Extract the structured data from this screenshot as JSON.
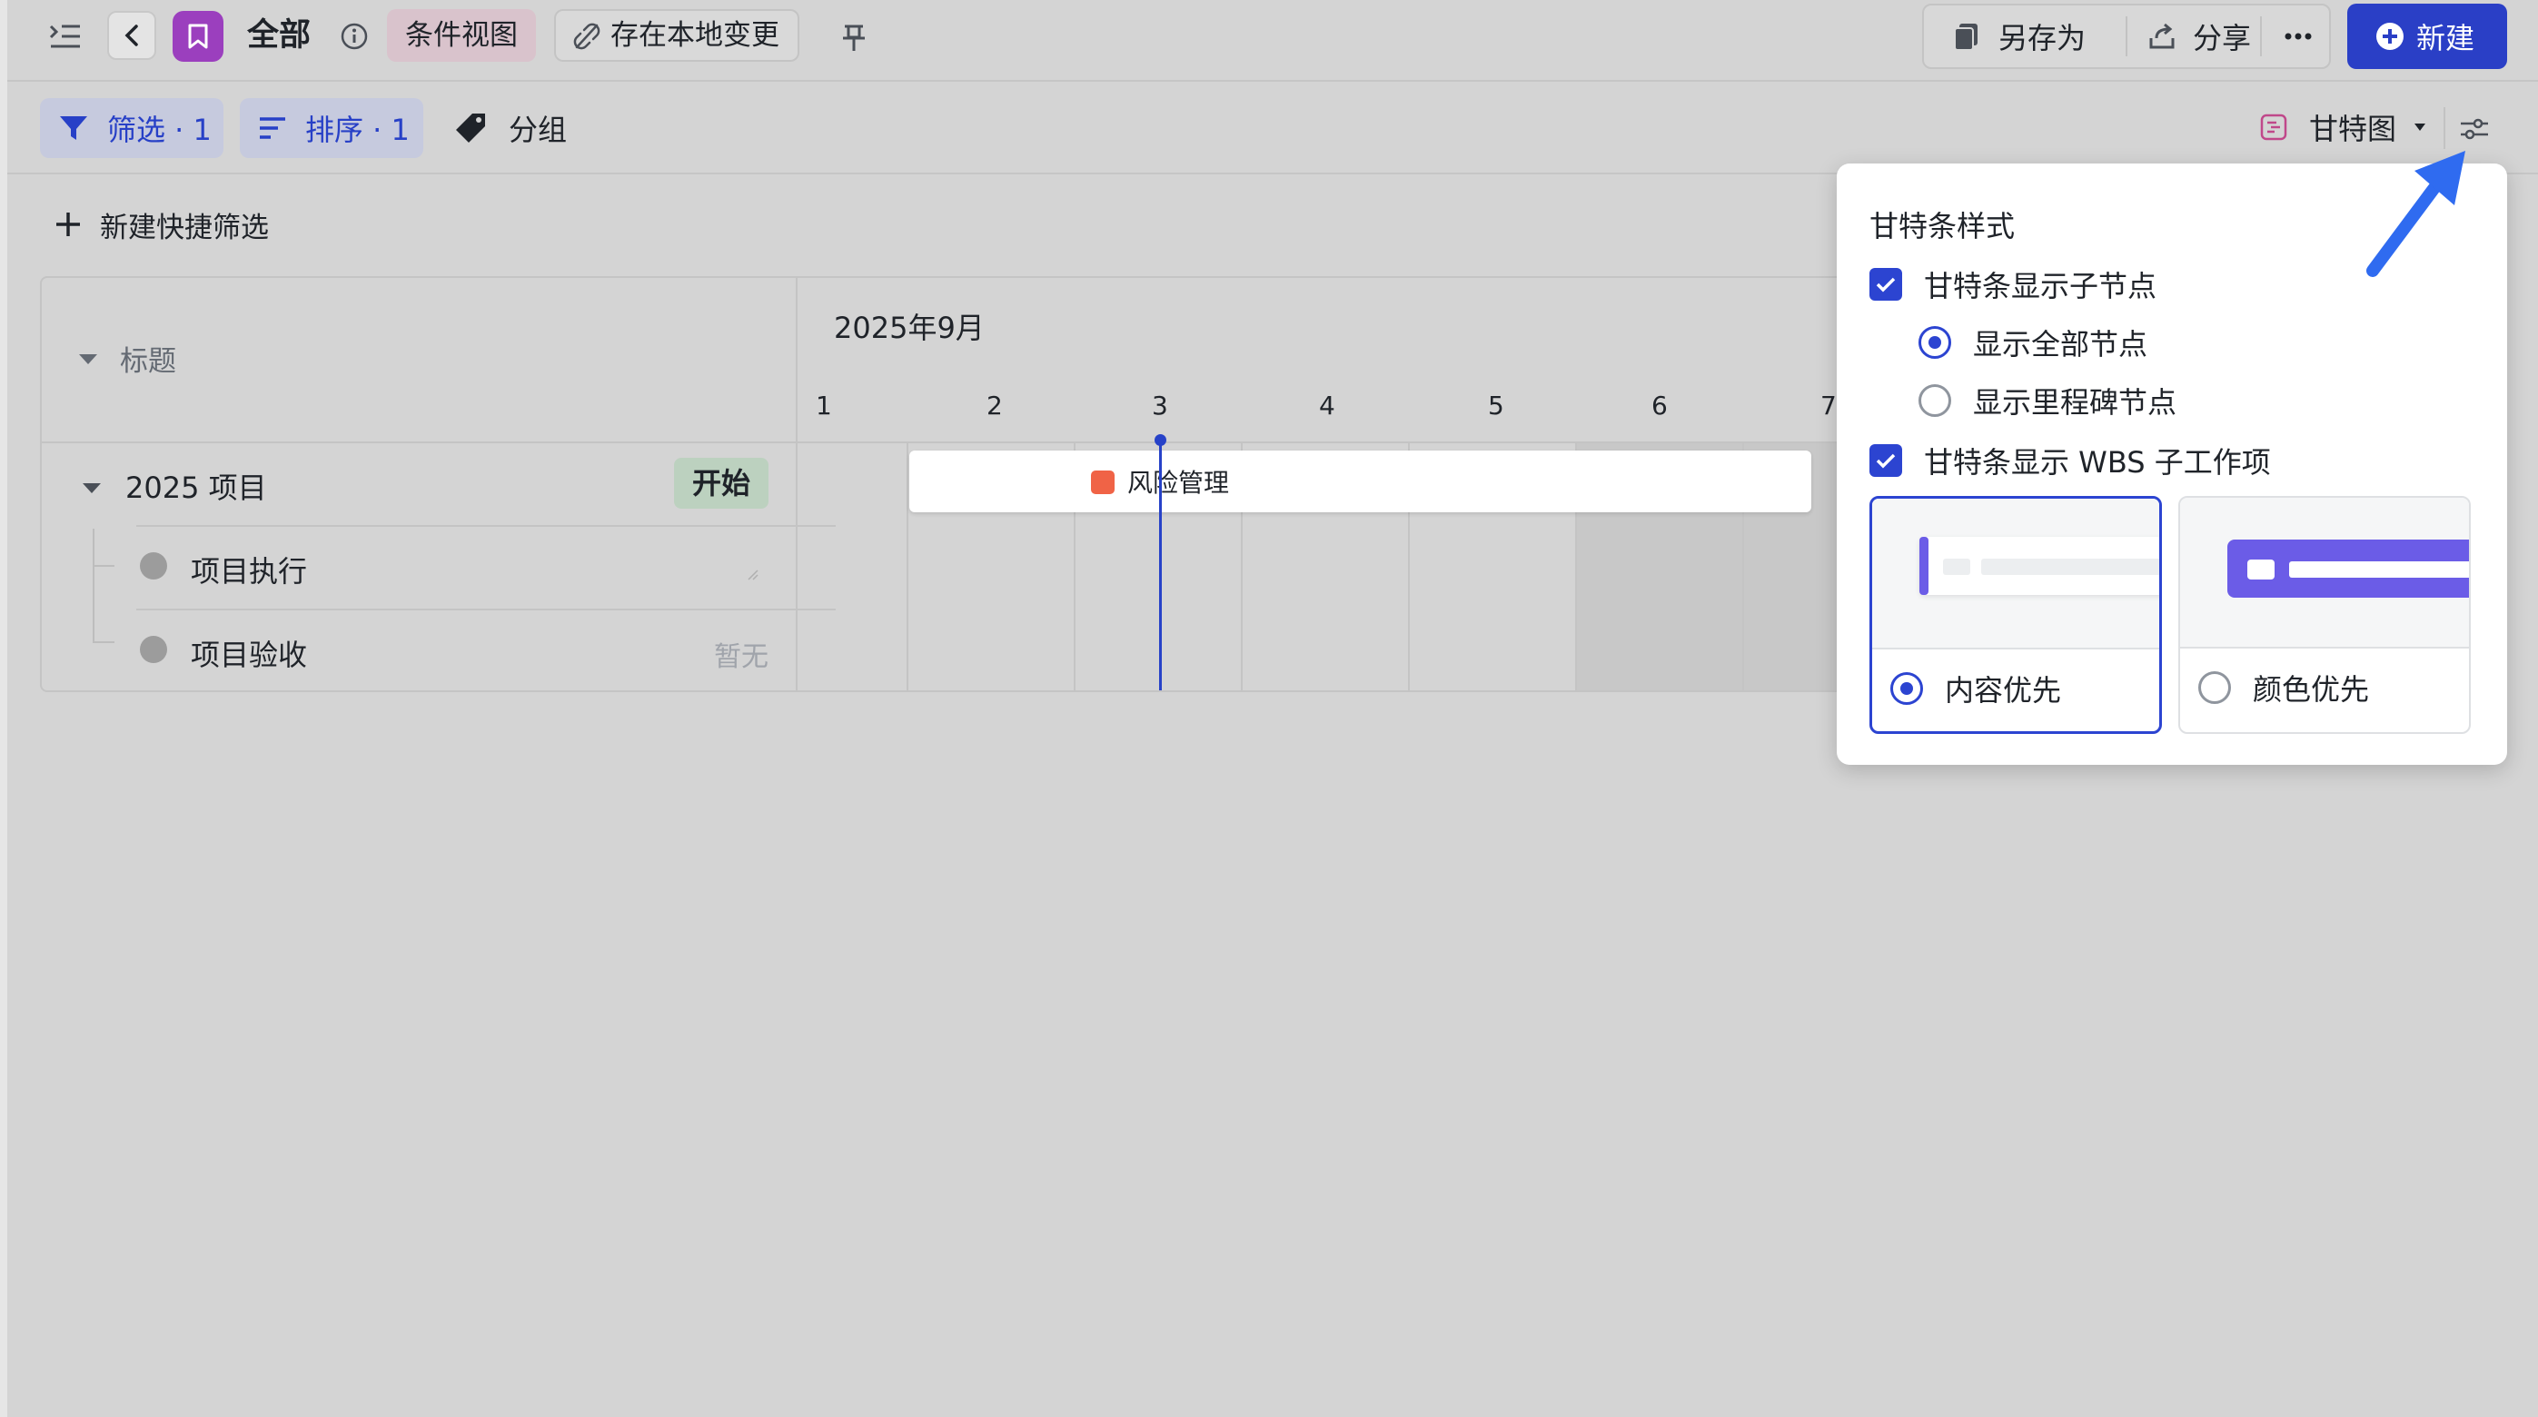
{
  "header": {
    "title": "全部",
    "view_chip": "条件视图",
    "local_chip": "存在本地变更",
    "save_as": "另存为",
    "share": "分享",
    "new_button": "新建"
  },
  "toolbar": {
    "filter": "筛选 · 1",
    "sort": "排序 · 1",
    "group": "分组",
    "view_type": "甘特图"
  },
  "quick_filter": "新建快捷筛选",
  "table": {
    "column_title": "标题",
    "month": "2025年9月",
    "days": [
      "1",
      "2",
      "3",
      "4",
      "5",
      "6",
      "7"
    ],
    "rows": [
      {
        "title": "2025 项目",
        "status": "开始",
        "bar_label": "风险管理"
      },
      {
        "title": "项目执行"
      },
      {
        "title": "项目验收",
        "status": "暂无"
      }
    ]
  },
  "popover": {
    "section_title": "甘特条样式",
    "show_children": "甘特条显示子节点",
    "show_all_nodes": "显示全部节点",
    "show_milestones": "显示里程碑节点",
    "show_wbs": "甘特条显示 WBS 子工作项",
    "style_content": "内容优先",
    "style_color": "颜色优先"
  },
  "colors": {
    "accent": "#2c44d1",
    "primary_button": "#2a3fc6",
    "view_logo": "#9b3fbe",
    "risk_marker": "#f06346",
    "annotation_arrow": "#2f6bf0"
  }
}
